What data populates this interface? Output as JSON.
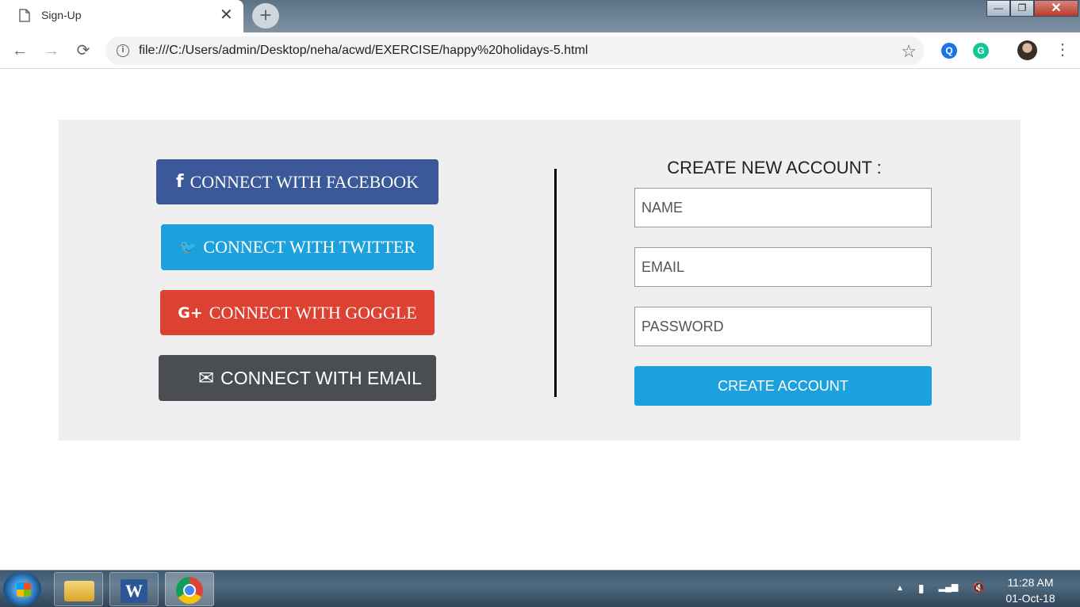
{
  "browser": {
    "tab_title": "Sign-Up",
    "tab_close": "✕",
    "new_tab": "+",
    "url": "file:///C:/Users/admin/Desktop/neha/acwd/EXERCISE/happy%20holidays-5.html",
    "window": {
      "minimize": "—",
      "maximize": "❐",
      "close": "✕"
    },
    "nav": {
      "back": "←",
      "forward": "→",
      "reload": "⟳"
    },
    "info_icon": "i",
    "star": "☆",
    "menu": "⋮",
    "ext_search": "Q",
    "ext_grammarly": "G"
  },
  "social": {
    "facebook": {
      "icon": "f",
      "label": "CONNECT WITH FACEBOOK"
    },
    "twitter": {
      "icon": "🐦",
      "label": "CONNECT WITH TWITTER"
    },
    "google": {
      "icon": "G+",
      "label": "CONNECT WITH GOGGLE"
    },
    "email": {
      "icon": "✉",
      "label": "CONNECT WITH EMAIL"
    }
  },
  "form": {
    "title": "CREATE NEW ACCOUNT :",
    "name_placeholder": "NAME",
    "email_placeholder": "EMAIL",
    "password_placeholder": "PASSWORD",
    "submit_label": "CREATE ACCOUNT"
  },
  "colors": {
    "facebook": "#3b5998",
    "twitter": "#1da1dd",
    "google": "#dd4132",
    "email": "#4a4d52",
    "panel": "#efefef"
  },
  "taskbar": {
    "word_letter": "W",
    "tray_icons": [
      "▲",
      "▮",
      "▂▄▆",
      "🔇"
    ],
    "time": "11:28 AM",
    "date": "01-Oct-18"
  }
}
